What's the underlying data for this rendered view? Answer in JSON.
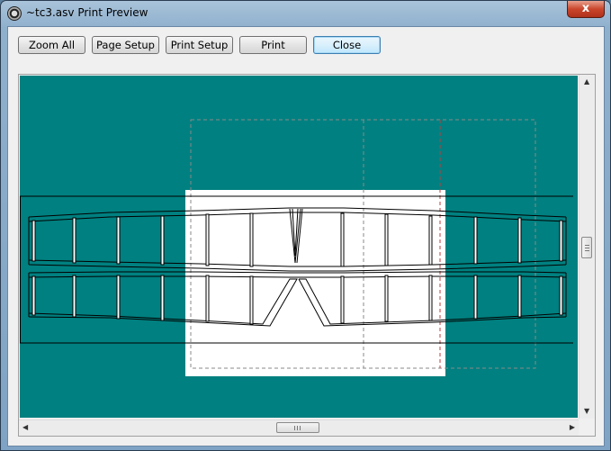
{
  "window": {
    "title": "~tc3.asv Print Preview",
    "close_glyph": "x"
  },
  "toolbar": {
    "zoom_all": "Zoom All",
    "page_setup": "Page Setup",
    "print_setup": "Print Setup",
    "print": "Print",
    "close": "Close"
  },
  "preview": {
    "background_color": "#008080",
    "page_color": "#ffffff",
    "drawing_color": "#000000",
    "page_boundary_color": "#b33a3a"
  },
  "icons": {
    "app": "app-icon",
    "close": "close-icon",
    "scroll_up": "scroll-up-arrow-icon",
    "scroll_down": "scroll-down-arrow-icon",
    "scroll_left": "scroll-left-arrow-icon",
    "scroll_right": "scroll-right-arrow-icon"
  }
}
